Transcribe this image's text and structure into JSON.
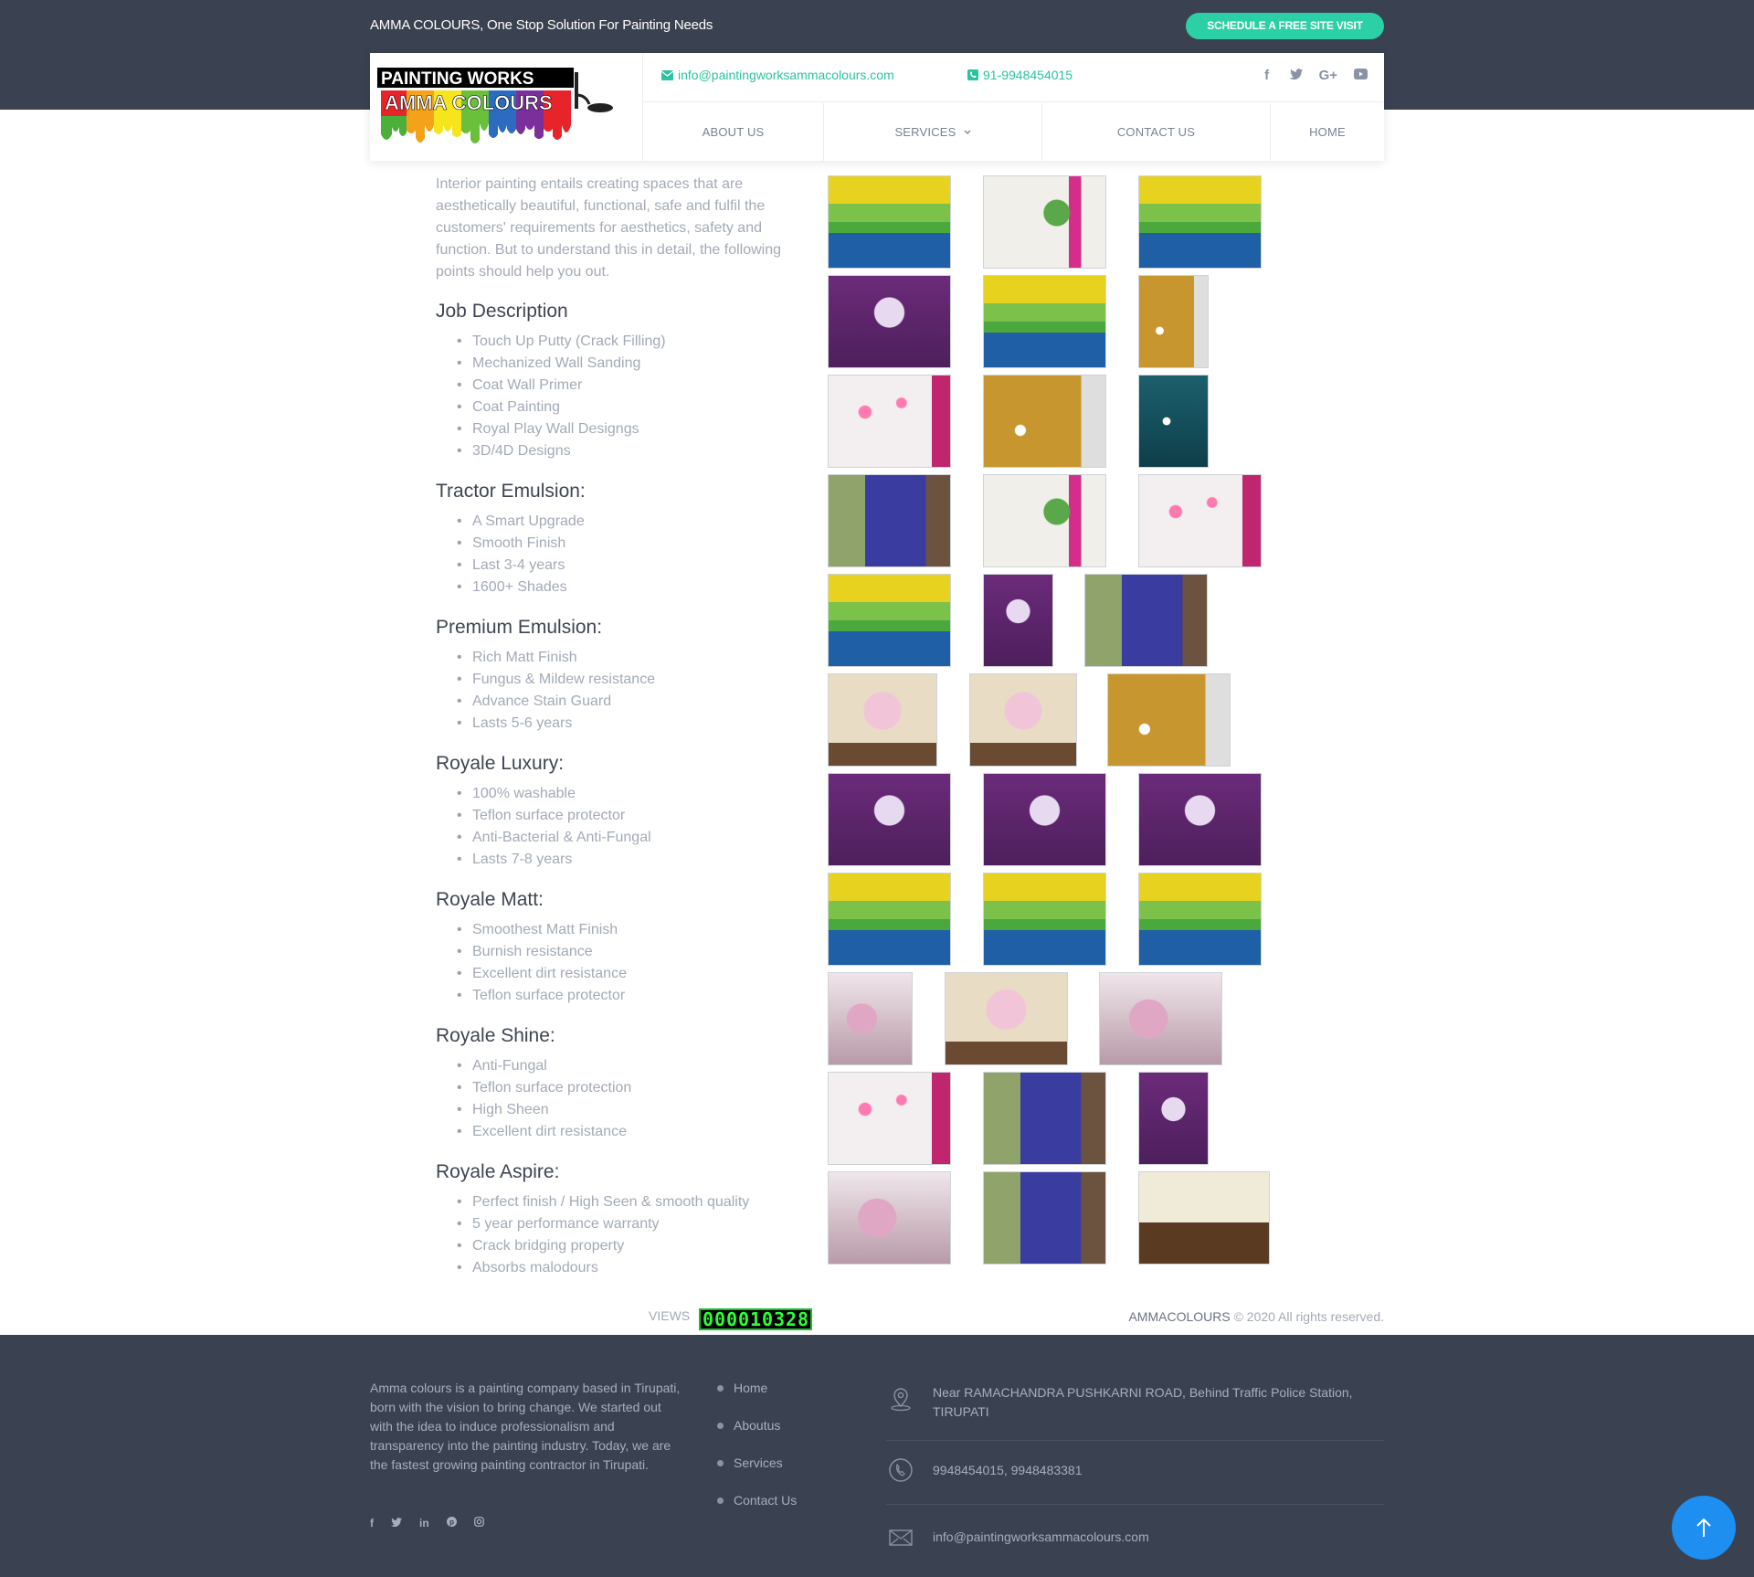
{
  "topbar": {
    "tagline": "AMMA COLOURS, One Stop Solution For Painting Needs",
    "cta_label": "SCHEDULE A FREE SITE VISIT"
  },
  "header": {
    "logo_line1": "PAINTING WORKS",
    "logo_line2": "AMMA COLOURS",
    "email": "info@paintingworksammacolours.com",
    "phone": "91-9948454015",
    "social_icons": [
      "facebook-icon",
      "twitter-icon",
      "google-plus-icon",
      "youtube-icon"
    ],
    "nav": [
      "ABOUT US",
      "SERVICES",
      "CONTACT US",
      "HOME"
    ]
  },
  "main": {
    "intro": "Interior painting entails creating spaces that are aesthetically beautiful, functional, safe and fulfil the customers' requirements for aesthetics, safety and function. But to understand this in detail, the following points should help you out.",
    "sections": [
      {
        "title": "Job Description",
        "items": [
          "Touch Up Putty (Crack Filling)",
          "Mechanized Wall Sanding",
          "Coat Wall Primer",
          "Coat Painting",
          "Royal Play  Wall Designgs",
          "3D/4D Designs"
        ]
      },
      {
        "title": "Tractor Emulsion:",
        "items": [
          "A Smart Upgrade",
          "Smooth Finish",
          "Last 3-4 years",
          "1600+ Shades"
        ]
      },
      {
        "title": "Premium Emulsion:",
        "items": [
          "Rich Matt Finish",
          "Fungus & Mildew resistance",
          "Advance Stain Guard",
          "Lasts 5-6 years"
        ]
      },
      {
        "title": "Royale Luxury:",
        "items": [
          "100% washable",
          "Teflon surface protector",
          "Anti-Bacterial & Anti-Fungal",
          "Lasts 7-8 years"
        ]
      },
      {
        "title": "Royale Matt:",
        "items": [
          "Smoothest Matt Finish",
          "Burnish resistance",
          "Excellent dirt resistance",
          "Teflon surface protector"
        ]
      },
      {
        "title": "Royale Shine:",
        "items": [
          "Anti-Fungal",
          "Teflon surface protection",
          "High Sheen",
          "Excellent dirt resistance"
        ]
      },
      {
        "title": "Royale Aspire:",
        "items": [
          "Perfect finish / High Seen & smooth quality",
          "5 year performance warranty",
          "Crack bridging property",
          "Absorbs malodours"
        ]
      }
    ]
  },
  "gallery": {
    "colors": {
      "stripe_yellow": "#e6d21f",
      "stripe_green": "#4aa83c",
      "stripe_blue": "#1e5fa6",
      "magenta": "#c0266d",
      "purple": "#6b2b7a",
      "teal": "#1c5f6d",
      "cream": "#e8dcc4",
      "gold": "#c8962e"
    }
  },
  "stats": {
    "views_label": "VIEWS",
    "view_count": "000010328",
    "brand": "AMMACOLOURS",
    "copyright": " © 2020 All rights reserved."
  },
  "footer": {
    "about": "Amma colours is a painting company based in Tirupati, born with the vision to bring change. We started out with the idea to induce professionalism and transparency into the painting industry. Today, we are the fastest growing painting contractor in Tirupati.",
    "links": [
      "Home",
      "Aboutus",
      "Services",
      "Contact Us"
    ],
    "social_icons": [
      "facebook-icon",
      "twitter-icon",
      "linkedin-icon",
      "pinterest-icon",
      "instagram-icon"
    ],
    "address": "Near RAMACHANDRA PUSHKARNI ROAD, Behind Traffic Police Station, TIRUPATI",
    "phones": "9948454015, 9948483381",
    "email": "info@paintingworksammacolours.com"
  }
}
